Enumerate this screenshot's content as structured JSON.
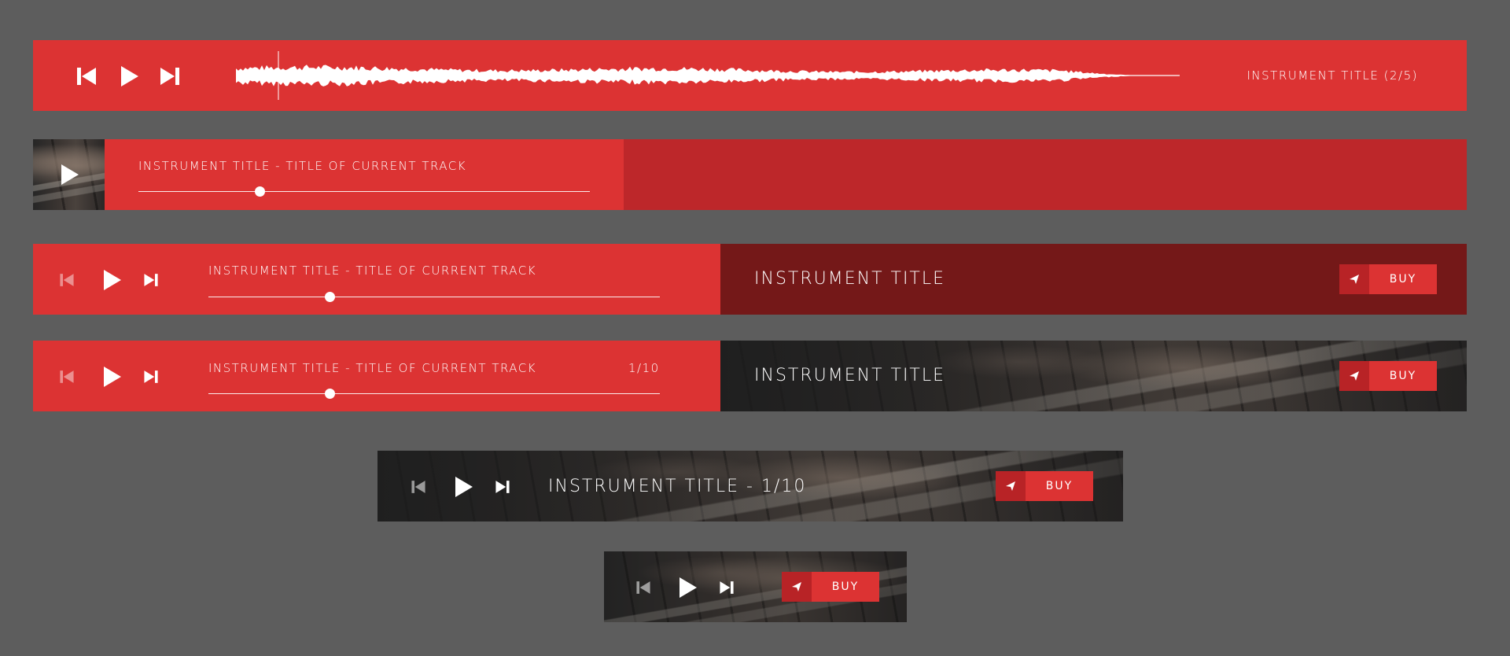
{
  "colors": {
    "background": "#5d5d5d",
    "accent_red": "#dc3333",
    "dark_red": "#bd272a",
    "darker_red": "#741818",
    "buy_icon_red": "#b82326"
  },
  "player1": {
    "title": "INSTRUMENT TITLE (2/5)",
    "icons": [
      "skip-back-icon",
      "play-icon",
      "skip-forward-icon"
    ]
  },
  "player2": {
    "track": "INSTRUMENT TITLE  - TITLE OF CURRENT TRACK",
    "progress": 0.27,
    "icons": [
      "play-icon"
    ]
  },
  "player3": {
    "track": "INSTRUMENT TITLE  - TITLE OF CURRENT TRACK",
    "progress": 0.27,
    "panel_title": "INSTRUMENT TITLE",
    "buy_label": "BUY",
    "icons": [
      "skip-back-icon",
      "play-icon",
      "skip-forward-icon",
      "send-icon"
    ]
  },
  "player4": {
    "track": "INSTRUMENT TITLE  - TITLE OF CURRENT TRACK",
    "counter": "1/10",
    "progress": 0.27,
    "panel_title": "INSTRUMENT TITLE",
    "buy_label": "BUY",
    "icons": [
      "skip-back-icon",
      "play-icon",
      "skip-forward-icon",
      "send-icon"
    ]
  },
  "player5": {
    "title": "INSTRUMENT TITLE - 1/10",
    "buy_label": "BUY",
    "icons": [
      "skip-back-icon",
      "play-icon",
      "skip-forward-icon",
      "send-icon"
    ]
  },
  "player6": {
    "buy_label": "BUY",
    "icons": [
      "skip-back-icon",
      "play-icon",
      "skip-forward-icon",
      "send-icon"
    ]
  }
}
